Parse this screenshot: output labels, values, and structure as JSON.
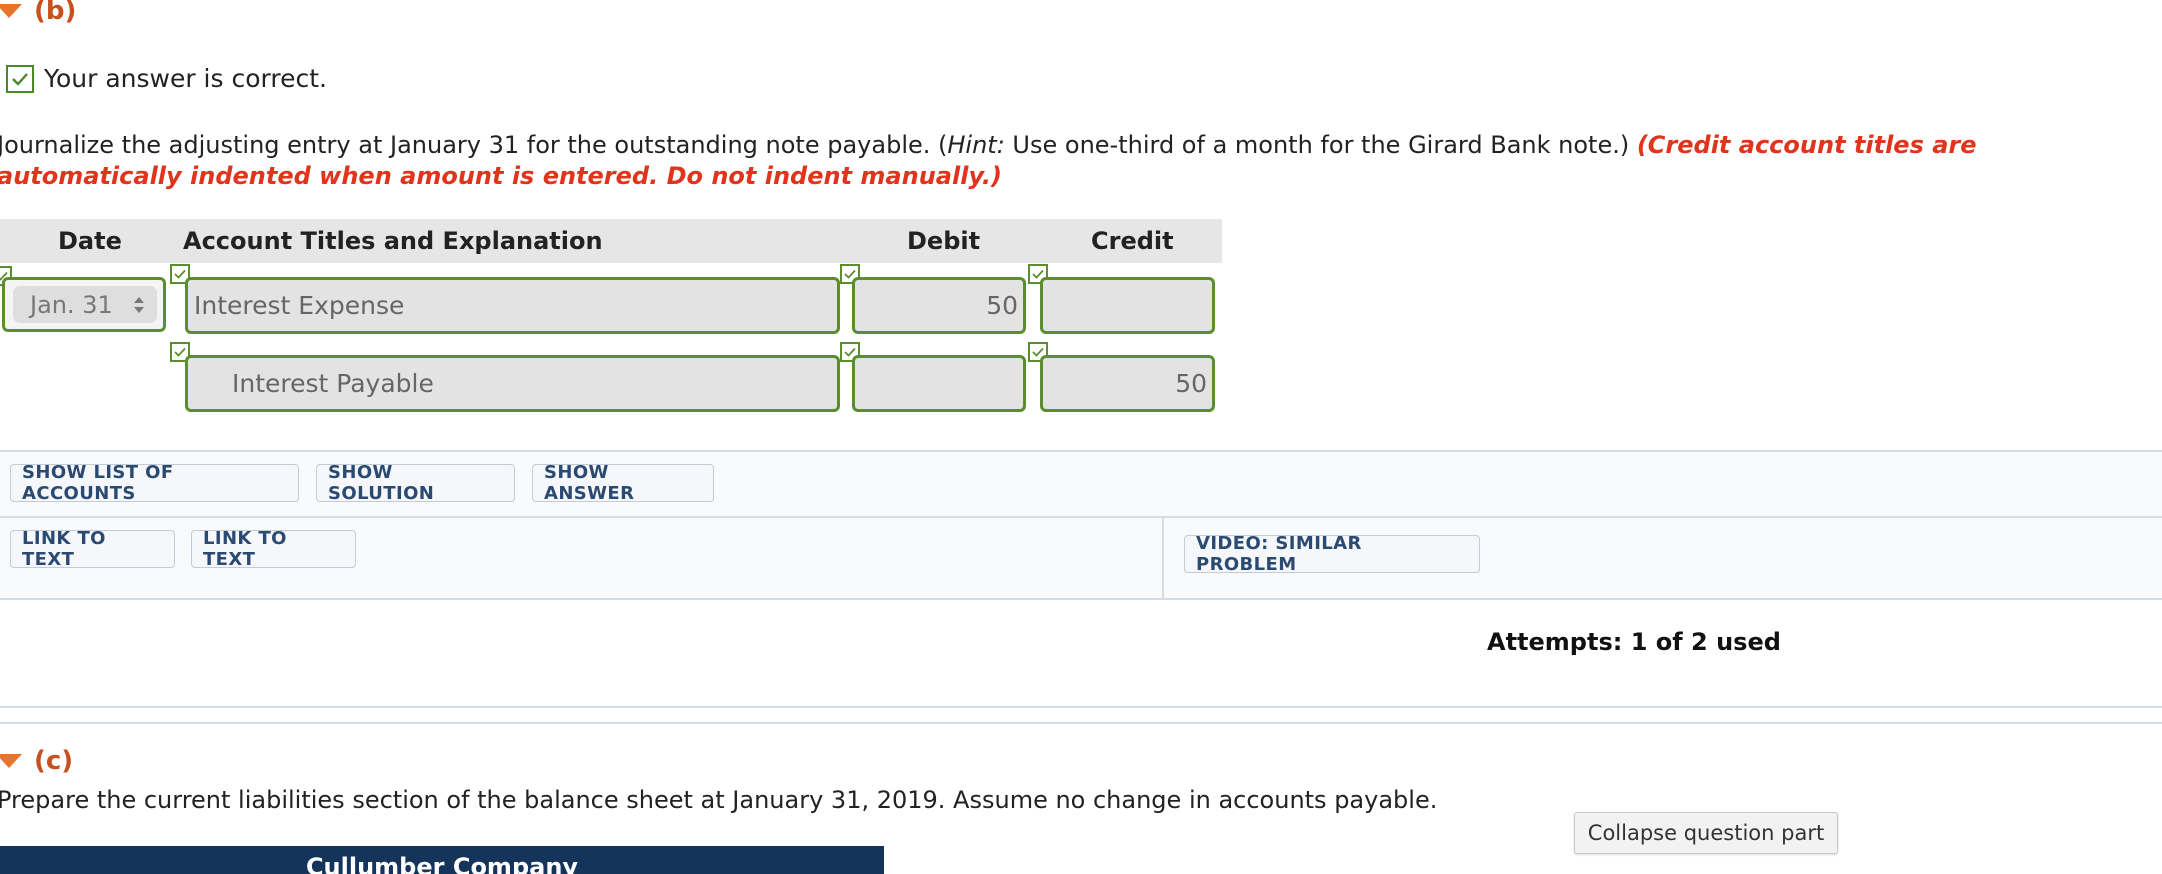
{
  "part_b": {
    "label": "(b)",
    "status": "Your answer is correct.",
    "instruction_main": "Journalize the adjusting entry at January 31 for the outstanding note payable. (",
    "instruction_hint_label": "Hint:",
    "instruction_hint_text": " Use one-third of a month for the Girard Bank note.) ",
    "instruction_red_line1": "(Credit account titles are",
    "instruction_red_line2": "automatically indented when amount is entered. Do not indent manually.)"
  },
  "journal_table": {
    "headers": {
      "date": "Date",
      "account": "Account Titles and Explanation",
      "debit": "Debit",
      "credit": "Credit"
    },
    "rows": [
      {
        "date": "Jan. 31",
        "account": "Interest Expense",
        "debit": "50",
        "credit": ""
      },
      {
        "date": "",
        "account": "Interest Payable",
        "debit": "",
        "credit": "50"
      }
    ]
  },
  "buttons": {
    "show_list": "SHOW LIST OF ACCOUNTS",
    "show_solution": "SHOW SOLUTION",
    "show_answer": "SHOW ANSWER",
    "link_text_1": "LINK TO TEXT",
    "link_text_2": "LINK TO TEXT",
    "video": "VIDEO: SIMILAR PROBLEM"
  },
  "attempts": "Attempts: 1 of 2 used",
  "part_c": {
    "label": "(c)",
    "instruction": "Prepare the current liabilities section of the balance sheet at January 31, 2019. Assume no change in accounts payable.",
    "company_header": "Cullumber Company"
  },
  "tooltip": "Collapse question part",
  "colors": {
    "accent_orange": "#e8742a",
    "check_green": "#5a8e2e",
    "red_text": "#e0341c",
    "navy_header": "#14345c",
    "button_text": "#2b4a72"
  }
}
